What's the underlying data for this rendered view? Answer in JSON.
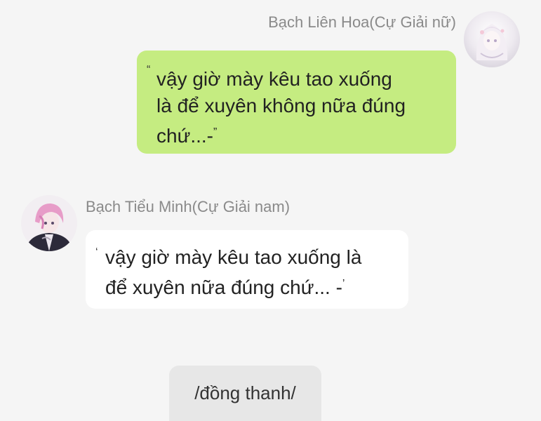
{
  "messages": {
    "right": {
      "sender": "Bạch Liên Hoa(Cự Giải nữ)",
      "open_quote": "“",
      "lines": [
        "vậy giờ mày kêu tao xuống",
        "là để xuyên không nữa đúng",
        "chứ...-"
      ],
      "close_quote": "”",
      "bubble_color": "#c5ec81"
    },
    "left": {
      "sender": "Bạch Tiểu Minh(Cự Giải nam)",
      "open_quote": "‘",
      "lines": [
        "vậy giờ mày kêu tao xuống là",
        "để xuyên nữa đúng chứ... -"
      ],
      "close_quote": "’",
      "bubble_color": "#ffffff"
    },
    "center": {
      "text": "/đồng thanh/"
    }
  },
  "colors": {
    "background": "#f5f5f5",
    "name_text": "#8a8a8a",
    "system_bubble": "#e7e7e7"
  }
}
